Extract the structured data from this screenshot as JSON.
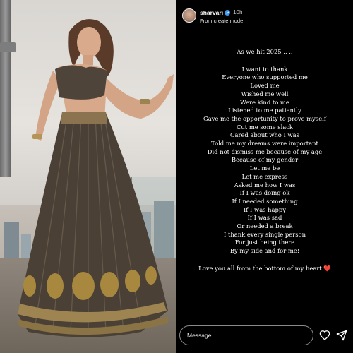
{
  "story": {
    "username": "sharvari",
    "time": "10h",
    "subtitle": "From create mode",
    "intro": "As we hit 2025 .. ..",
    "lines": [
      "I want to thank",
      "Everyone who supported me",
      "Loved me",
      "Wished me well",
      "Were kind to me",
      "Listened to me patiently",
      "Gave me the opportunity to prove myself",
      "Cut me some slack",
      "Cared about who I was",
      "Told me my dreams were important",
      "Did not dismiss me because of my age",
      "Because of my gender",
      "Let me be",
      "Let me express",
      "Asked me how I was",
      "If I was doing ok",
      "If I needed something",
      "If I was happy",
      "If I was sad",
      "Or needed a break",
      "I thank every single person",
      "For just being there",
      "By my side and for me!"
    ],
    "closing": "Love you all from the bottom of my heart",
    "heart": "❤️"
  },
  "footer": {
    "message_placeholder": "Message"
  },
  "icons": {
    "verified": "verified-badge-icon",
    "like": "heart-icon",
    "share": "send-icon"
  },
  "colors": {
    "verified_badge": "#3897f0",
    "heart": "#e0302f",
    "background": "#000000"
  }
}
